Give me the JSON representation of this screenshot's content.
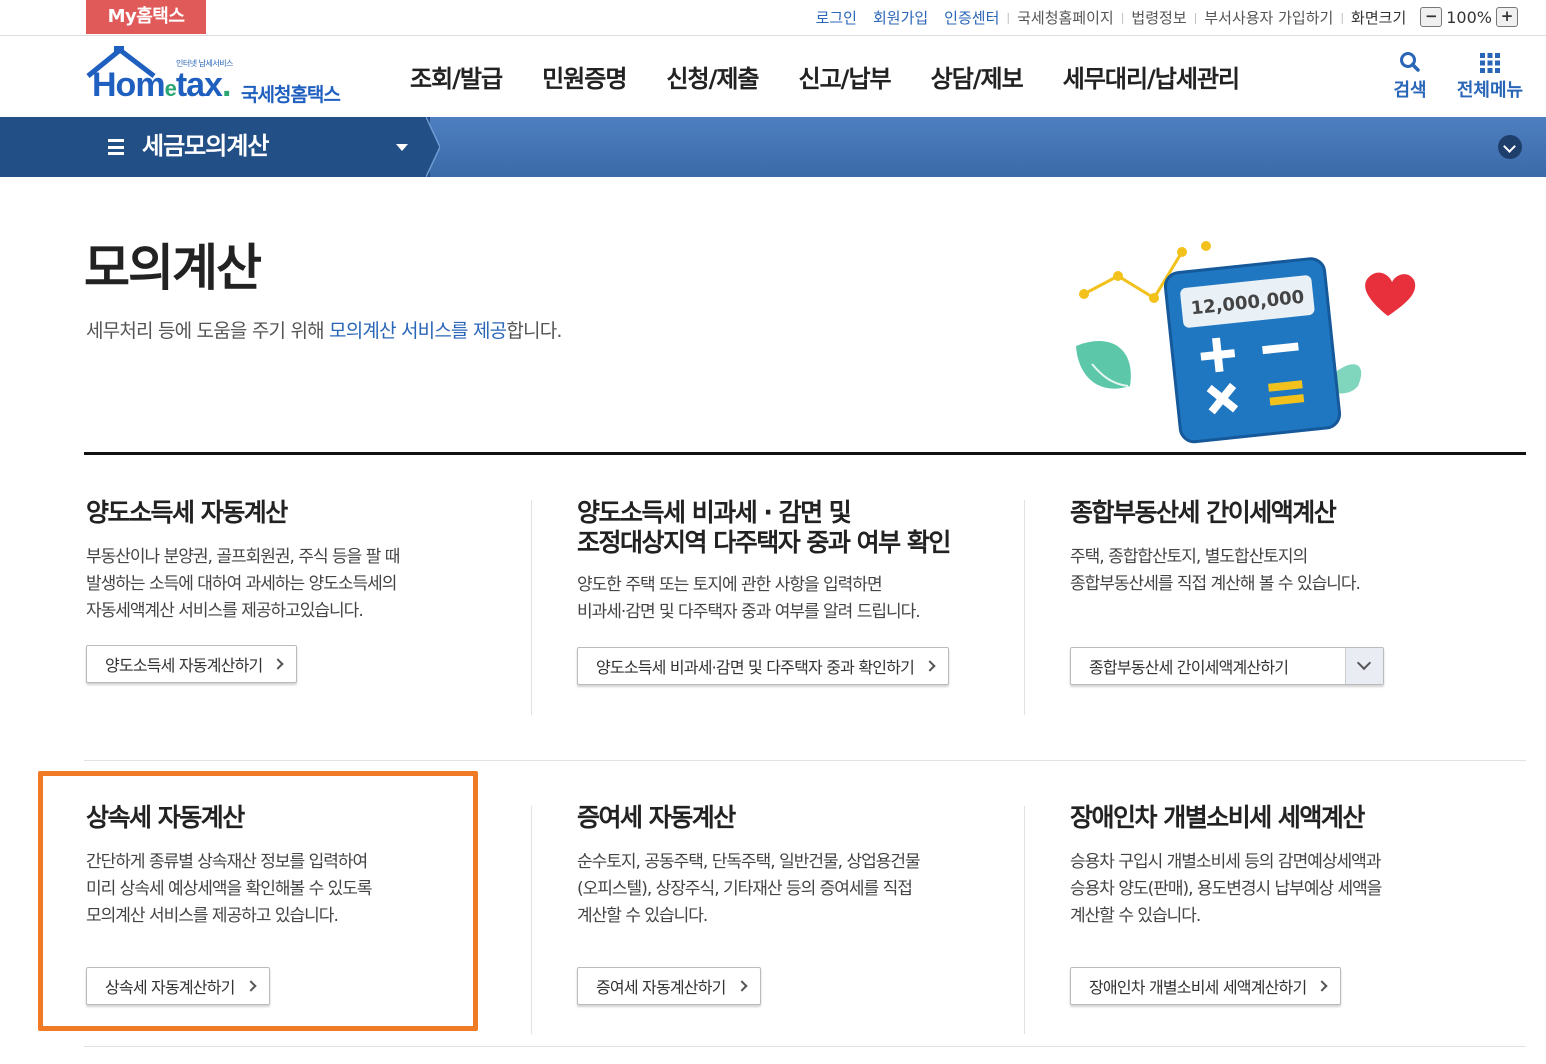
{
  "topbar": {
    "my_tab": "My홈택스",
    "links": [
      "로그인",
      "회원가입",
      "인증센터",
      "국세청홈페이지",
      "법령정보",
      "부서사용자 가입하기",
      "화면크기"
    ],
    "zoom_minus": "−",
    "zoom_value": "100%",
    "zoom_plus": "+"
  },
  "header": {
    "logo_tag": "인터넷 납세서비스",
    "logo_word_prefix": "Hom",
    "logo_word_e": "e",
    "logo_word_suffix": "tax",
    "logo_dot": ".",
    "logo_korean": "국세청홈택스",
    "nav": [
      "조회/발급",
      "민원증명",
      "신청/제출",
      "신고/납부",
      "상담/제보",
      "세무대리/납세관리"
    ],
    "search_label": "검색",
    "menu_label": "전체메뉴"
  },
  "subnav": {
    "title": "세금모의계산"
  },
  "intro": {
    "title": "모의계산",
    "desc_before": "세무처리 등에 도움을 주기 위해 ",
    "desc_highlight": "모의계산 서비스를 제공",
    "desc_after": "합니다.",
    "illust_amount": "12,000,000"
  },
  "cards": [
    {
      "title": "양도소득세 자동계산",
      "lines": [
        "부동산이나 분양권, 골프회원권, 주식 등을 팔 때",
        "발생하는 소득에 대하여 과세하는 양도소득세의",
        "자동세액계산 서비스를 제공하고있습니다."
      ],
      "button": "양도소득세 자동계산하기"
    },
    {
      "title_line1": "양도소득세 비과세 · 감면 및",
      "title_line2": "조정대상지역 다주택자 중과 여부 확인",
      "lines": [
        "양도한 주택 또는 토지에 관한 사항을 입력하면",
        "비과세·감면 및 다주택자 중과 여부를 알려 드립니다."
      ],
      "button": "양도소득세 비과세·감면 및 다주택자 중과 확인하기"
    },
    {
      "title": "종합부동산세 간이세액계산",
      "lines": [
        "주택, 종합합산토지, 별도합산토지의",
        "종합부동산세를 직접 계산해 볼 수 있습니다."
      ],
      "button": "종합부동산세 간이세액계산하기"
    },
    {
      "title": "상속세 자동계산",
      "lines": [
        "간단하게 종류별 상속재산 정보를 입력하여",
        "미리 상속세 예상세액을 확인해볼 수 있도록",
        "모의계산 서비스를 제공하고 있습니다."
      ],
      "button": "상속세 자동계산하기"
    },
    {
      "title": "증여세 자동계산",
      "lines": [
        "순수토지, 공동주택, 단독주택, 일반건물, 상업용건물",
        "(오피스텔), 상장주식, 기타재산 등의 증여세를 직접",
        "계산할 수 있습니다."
      ],
      "button": "증여세 자동계산하기"
    },
    {
      "title": "장애인차 개별소비세 세액계산",
      "lines": [
        "승용차 구입시 개별소비세 등의 감면예상세액과",
        "승용차 양도(판매), 용도변경시 납부예상 세액을",
        "계산할 수 있습니다."
      ],
      "button": "장애인차 개별소비세 세액계산하기"
    }
  ],
  "colors": {
    "brand_blue": "#2a66b8",
    "subnav_dark": "#224f86",
    "my_tab_red": "#e05a5a",
    "highlight_orange": "#f07b24"
  }
}
